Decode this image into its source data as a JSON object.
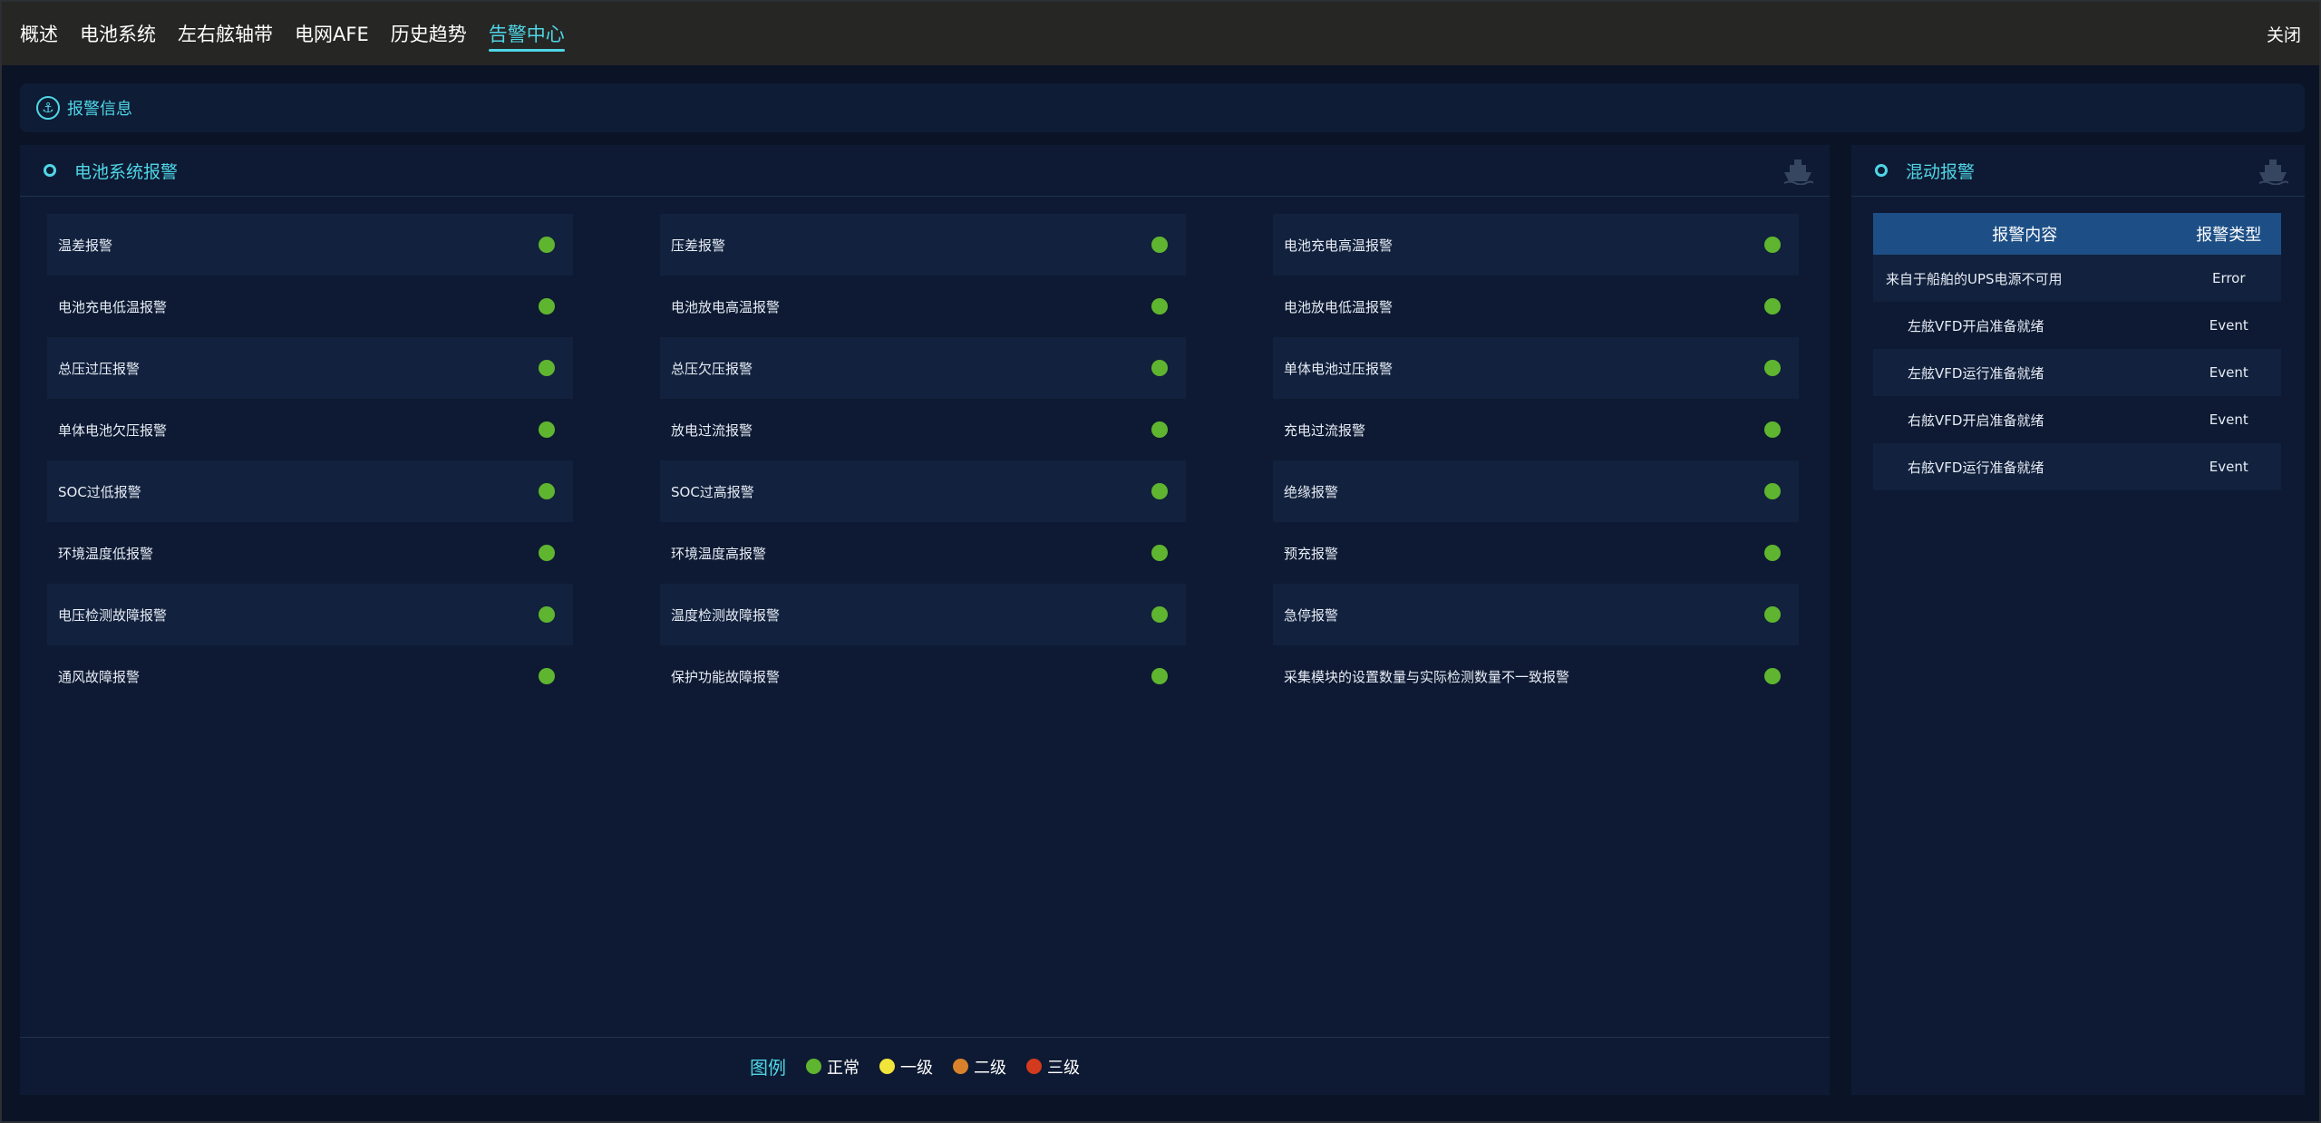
{
  "nav": {
    "items": [
      {
        "label": "概述",
        "active": false
      },
      {
        "label": "电池系统",
        "active": false
      },
      {
        "label": "左右舷轴带",
        "active": false
      },
      {
        "label": "电网AFE",
        "active": false
      },
      {
        "label": "历史趋势",
        "active": false
      },
      {
        "label": "告警中心",
        "active": true
      }
    ],
    "close_label": "关闭"
  },
  "info_bar": {
    "title": "报警信息",
    "icon": "anchor-icon"
  },
  "battery_panel": {
    "title": "电池系统报警",
    "alarms": [
      "温差报警",
      "压差报警",
      "电池充电高温报警",
      "电池充电低温报警",
      "电池放电高温报警",
      "电池放电低温报警",
      "总压过压报警",
      "总压欠压报警",
      "单体电池过压报警",
      "单体电池欠压报警",
      "放电过流报警",
      "充电过流报警",
      "SOC过低报警",
      "SOC过高报警",
      "绝缘报警",
      "环境温度低报警",
      "环境温度高报警",
      "预充报警",
      "电压检测故障报警",
      "温度检测故障报警",
      "急停报警",
      "通风故障报警",
      "保护功能故障报警",
      "采集模块的设置数量与实际检测数量不一致报警"
    ],
    "status_color": "#5fb52f"
  },
  "legend": {
    "title": "图例",
    "entries": [
      {
        "label": "正常",
        "color": "#5fb52f"
      },
      {
        "label": "一级",
        "color": "#f2e53a"
      },
      {
        "label": "二级",
        "color": "#d9822b"
      },
      {
        "label": "三级",
        "color": "#d33a1e"
      }
    ]
  },
  "mixed_panel": {
    "title": "混动报警",
    "columns": [
      "报警内容",
      "报警类型"
    ],
    "rows": [
      {
        "content": "来自于船舶的UPS电源不可用",
        "type": "Error"
      },
      {
        "content": "左舷VFD开启准备就绪",
        "type": "Event"
      },
      {
        "content": "左舷VFD运行准备就绪",
        "type": "Event"
      },
      {
        "content": "右舷VFD开启准备就绪",
        "type": "Event"
      },
      {
        "content": "右舷VFD运行准备就绪",
        "type": "Event"
      }
    ]
  },
  "colors": {
    "accent": "#4fd6e6",
    "background": "#0a1426",
    "panel": "#0e1a33",
    "table_header": "#1d4f86"
  }
}
